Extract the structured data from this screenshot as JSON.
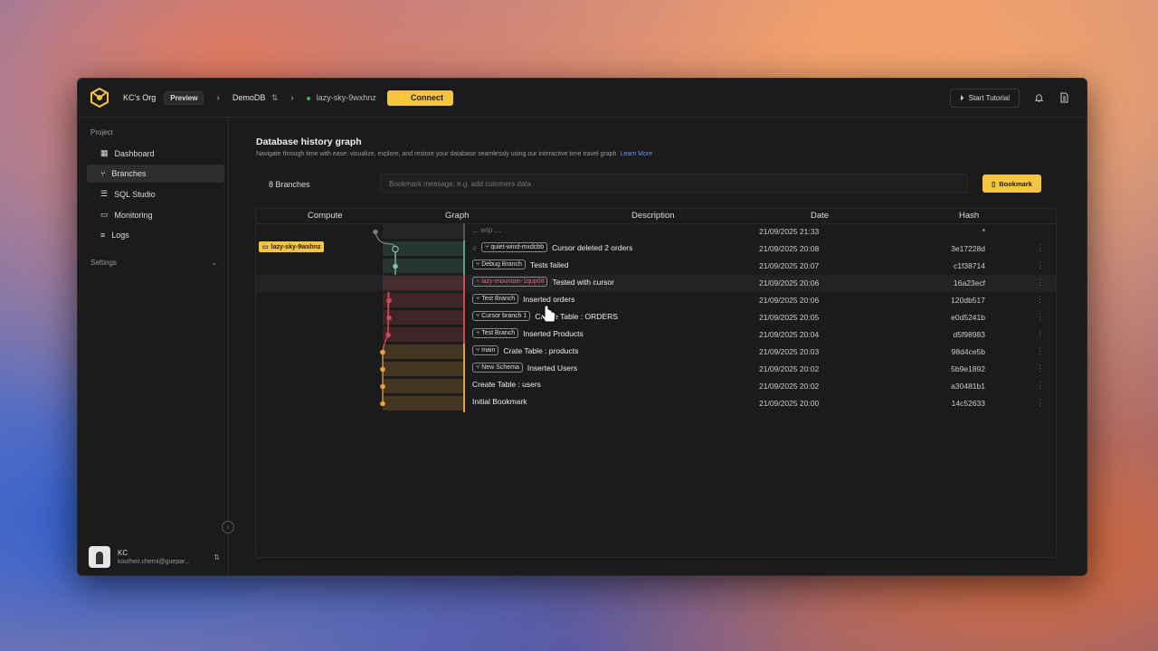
{
  "topbar": {
    "org": "KC's Org",
    "org_badge": "Preview",
    "database": "DemoDB",
    "branch": "lazy-sky-9wxhnz",
    "connect_label": "Connect",
    "tutorial_label": "Start Tutorial"
  },
  "sidebar": {
    "section_project": "Project",
    "items": [
      {
        "label": "Dashboard",
        "icon": "dashboard-icon"
      },
      {
        "label": "Branches",
        "icon": "branches-icon"
      },
      {
        "label": "SQL Studio",
        "icon": "sql-studio-icon"
      },
      {
        "label": "Monitoring",
        "icon": "monitoring-icon"
      },
      {
        "label": "Logs",
        "icon": "logs-icon"
      }
    ],
    "section_settings": "Settings",
    "user": {
      "name": "KC",
      "email": "koutheir.cherni@guepar..."
    }
  },
  "main": {
    "title": "Database history graph",
    "subtitle": "Navigate through time with ease: visualize, explore, and restore your database seamlessly using our interactive time travel graph",
    "learn_more": "Learn More",
    "branches_count": "8 Branches",
    "bookmark_placeholder": "Bookmark message, e.g. add cutomers data",
    "bookmark_button": "Bookmark",
    "columns": {
      "compute": "Compute",
      "graph": "Graph",
      "description": "Description",
      "date": "Date",
      "hash": "Hash"
    },
    "compute_tag": "lazy-sky-9wxhnz",
    "rows": [
      {
        "tag": "",
        "description": "... wip ...",
        "date": "21/09/2025 21:33",
        "hash": "*",
        "color": "#555555"
      },
      {
        "tag": "quiet-wind-mxdcbb",
        "description": "Cursor deleted 2 orders",
        "date": "21/09/2025 20:08",
        "hash": "3e17228d",
        "color": "#5aa08a"
      },
      {
        "tag": "Debug Branch",
        "description": "Tests failed",
        "date": "21/09/2025 20:07",
        "hash": "c1f38714",
        "color": "#5aa08a"
      },
      {
        "tag": "lazy-mountain-1qup08",
        "description": "Tested with cursor",
        "date": "21/09/2025 20:06",
        "hash": "16a23ecf",
        "color": "#d04a5a"
      },
      {
        "tag": "Test Branch",
        "description": "Inserted orders",
        "date": "21/09/2025 20:06",
        "hash": "120db517",
        "color": "#d04a5a"
      },
      {
        "tag": "Cursor branch 1",
        "description": "Create Table : ORDERS",
        "date": "21/09/2025 20:05",
        "hash": "e0d5241b",
        "color": "#d04a5a"
      },
      {
        "tag": "Test Branch",
        "description": "Inserted Products",
        "date": "21/09/2025 20:04",
        "hash": "d5f98983",
        "color": "#d04a5a"
      },
      {
        "tag": "main",
        "description": "Crate Table : products",
        "date": "21/09/2025 20:03",
        "hash": "98d4ce5b",
        "color": "#e8a23a"
      },
      {
        "tag": "New Schema",
        "description": "Inserted Users",
        "date": "21/09/2025 20:02",
        "hash": "5b9e1892",
        "color": "#e8a23a"
      },
      {
        "tag": "",
        "description": "Create Table : users",
        "date": "21/09/2025 20:02",
        "hash": "a30481b1",
        "color": "#e8a23a"
      },
      {
        "tag": "",
        "description": "Initial Bookmark",
        "date": "21/09/2025 20:00",
        "hash": "14c52633",
        "color": "#e8a23a"
      }
    ]
  }
}
